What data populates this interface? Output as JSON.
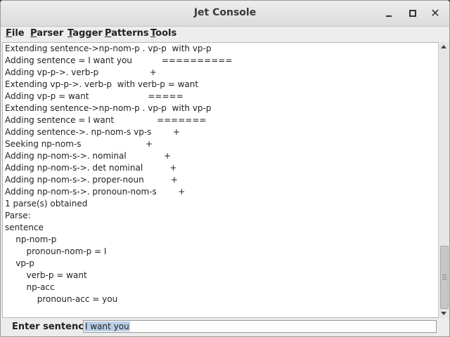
{
  "window": {
    "title": "Jet Console"
  },
  "menu": [
    {
      "mnemonic": "F",
      "rest": "ile"
    },
    {
      "mnemonic": "P",
      "rest": "arser"
    },
    {
      "mnemonic": "T",
      "rest": "agger"
    },
    {
      "mnemonic": "P",
      "rest": "atterns"
    },
    {
      "mnemonic": "T",
      "rest": "ools"
    }
  ],
  "output_lines": [
    "Extending sentence->np-nom-p . vp-p  with vp-p",
    "Adding sentence = I want you           ==========",
    "Adding vp-p->. verb-p                   +",
    "Extending vp-p->. verb-p  with verb-p = want",
    "Adding vp-p = want                      =====",
    "Extending sentence->np-nom-p . vp-p  with vp-p",
    "Adding sentence = I want                =======",
    "Adding sentence->. np-nom-s vp-s        +",
    "Seeking np-nom-s                        +",
    "Adding np-nom-s->. nominal              +",
    "Adding np-nom-s->. det nominal          +",
    "Adding np-nom-s->. proper-noun          +",
    "Adding np-nom-s->. pronoun-nom-s        +",
    "1 parse(s) obtained",
    "Parse:",
    "sentence",
    "    np-nom-p",
    "        pronoun-nom-p = I",
    "    vp-p",
    "        verb-p = want",
    "        np-acc",
    "            pronoun-acc = you"
  ],
  "input": {
    "label": "Enter sentence:",
    "value": "I want you"
  },
  "icons": {
    "minimize": "minimize-icon",
    "maximize": "maximize-icon",
    "close": "close-icon"
  }
}
